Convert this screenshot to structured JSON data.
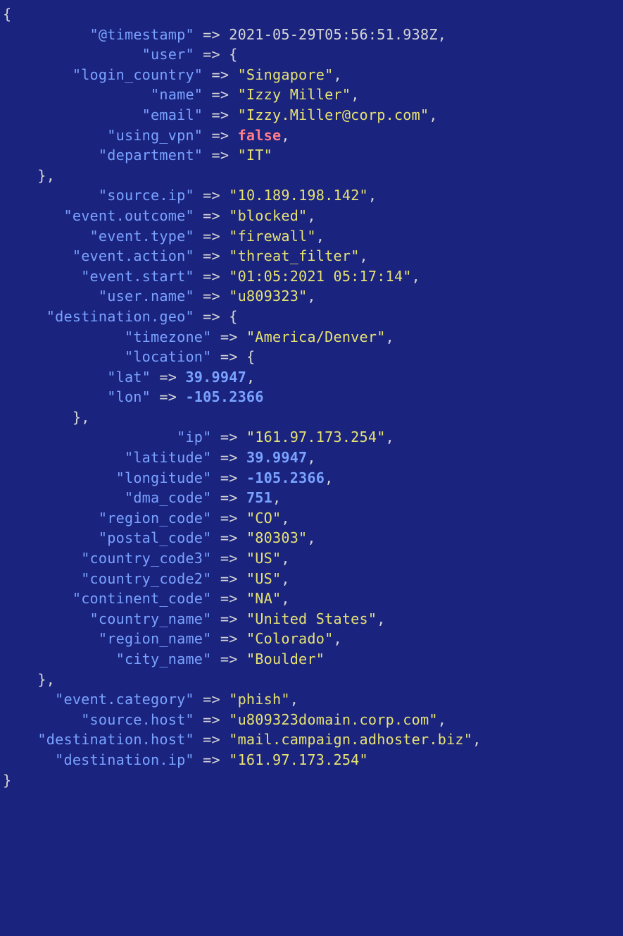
{
  "k_timestamp": "\"@timestamp\"",
  "v_timestamp": "2021-05-29T05:56:51.938Z",
  "k_user": "\"user\"",
  "k_login_country": "\"login_country\"",
  "v_login_country": "\"Singapore\"",
  "k_name": "\"name\"",
  "v_name": "\"Izzy Miller\"",
  "k_email": "\"email\"",
  "v_email": "\"Izzy.Miller@corp.com\"",
  "k_using_vpn": "\"using_vpn\"",
  "v_using_vpn": "false",
  "k_department": "\"department\"",
  "v_department": "\"IT\"",
  "k_source_ip": "\"source.ip\"",
  "v_source_ip": "\"10.189.198.142\"",
  "k_event_outcome": "\"event.outcome\"",
  "v_event_outcome": "\"blocked\"",
  "k_event_type": "\"event.type\"",
  "v_event_type": "\"firewall\"",
  "k_event_action": "\"event.action\"",
  "v_event_action": "\"threat_filter\"",
  "k_event_start": "\"event.start\"",
  "v_event_start": "\"01:05:2021 05:17:14\"",
  "k_user_name": "\"user.name\"",
  "v_user_name": "\"u809323\"",
  "k_dest_geo": "\"destination.geo\"",
  "k_timezone": "\"timezone\"",
  "v_timezone": "\"America/Denver\"",
  "k_location": "\"location\"",
  "k_lat": "\"lat\"",
  "v_lat": "39.9947",
  "k_lon": "\"lon\"",
  "v_lon": "-105.2366",
  "k_ip": "\"ip\"",
  "v_ip": "\"161.97.173.254\"",
  "k_latitude": "\"latitude\"",
  "v_latitude": "39.9947",
  "k_longitude": "\"longitude\"",
  "v_longitude": "-105.2366",
  "k_dma_code": "\"dma_code\"",
  "v_dma_code": "751",
  "k_region_code": "\"region_code\"",
  "v_region_code": "\"CO\"",
  "k_postal_code": "\"postal_code\"",
  "v_postal_code": "\"80303\"",
  "k_country_code3": "\"country_code3\"",
  "v_country_code3": "\"US\"",
  "k_country_code2": "\"country_code2\"",
  "v_country_code2": "\"US\"",
  "k_continent_code": "\"continent_code\"",
  "v_continent_code": "\"NA\"",
  "k_country_name": "\"country_name\"",
  "v_country_name": "\"United States\"",
  "k_region_name": "\"region_name\"",
  "v_region_name": "\"Colorado\"",
  "k_city_name": "\"city_name\"",
  "v_city_name": "\"Boulder\"",
  "k_event_category": "\"event.category\"",
  "v_event_category": "\"phish\"",
  "k_source_host": "\"source.host\"",
  "v_source_host": "\"u809323domain.corp.com\"",
  "k_dest_host": "\"destination.host\"",
  "v_dest_host": "\"mail.campaign.adhoster.biz\"",
  "k_dest_ip": "\"destination.ip\"",
  "v_dest_ip": "\"161.97.173.254\"",
  "arrow": " => ",
  "comma": ",",
  "obrace": "{",
  "cbrace": "}",
  "cbracec": "},"
}
